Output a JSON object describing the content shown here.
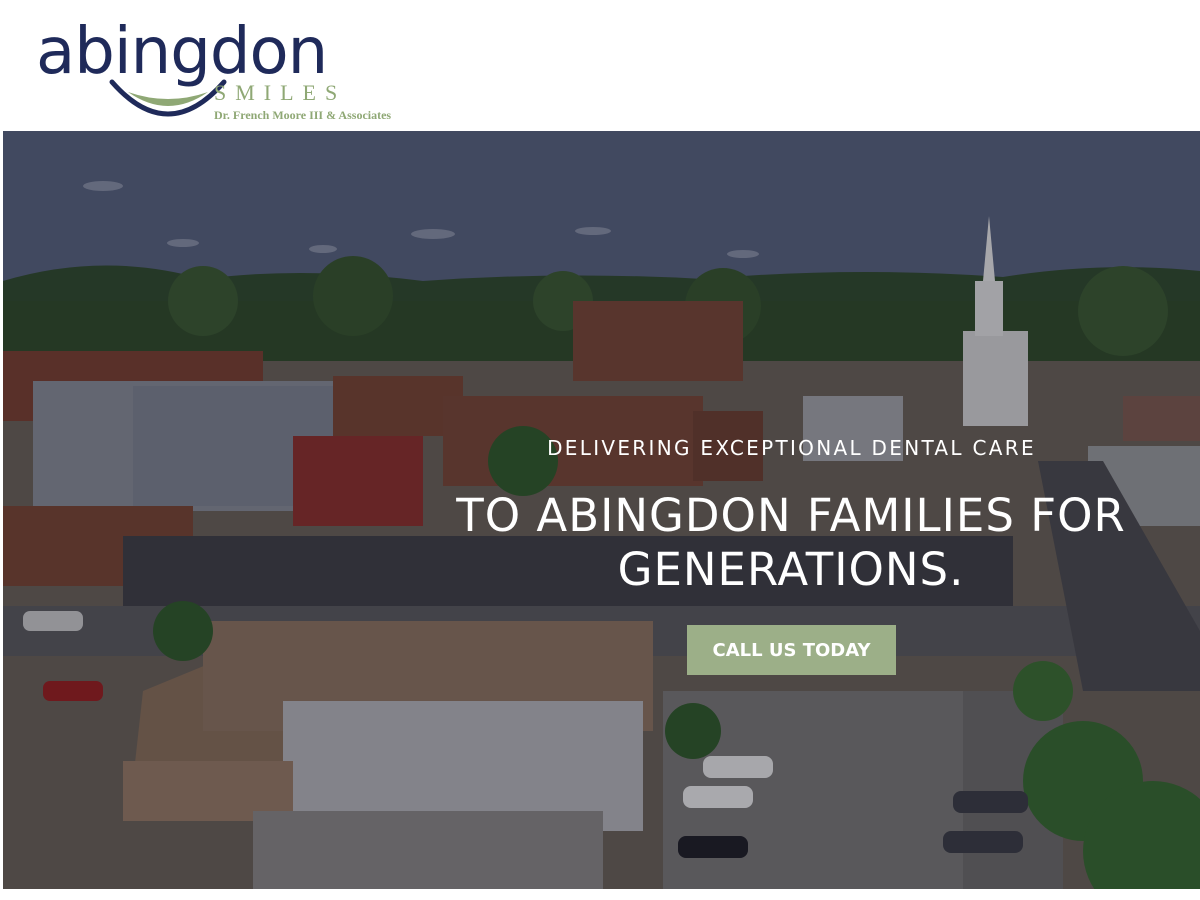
{
  "logo": {
    "wordmark": "abingdon",
    "tagline": "SMILES",
    "subtitle": "Dr. French Moore III & Associates",
    "colors": {
      "navy": "#1f2a5a",
      "sage": "#8fa875"
    }
  },
  "hero": {
    "eyebrow": "DELIVERING EXCEPTIONAL DENTAL CARE",
    "title_line1": "TO ABINGDON FAMILIES FOR",
    "title_line2": "GENERATIONS.",
    "cta_label": "CALL US TODAY",
    "cta_color": "#9caf88",
    "background": "aerial-town-photo"
  }
}
